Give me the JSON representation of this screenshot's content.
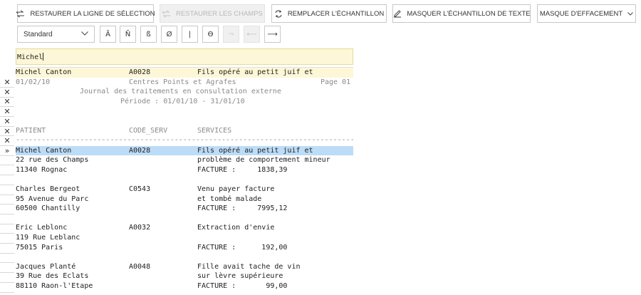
{
  "toolbar": {
    "restore_selection_line": "RESTAURER LA LIGNE DE SÉLECTION",
    "restore_fields": "RESTAURER LES CHAMPS",
    "replace_sample": "REMPLACER L'ÉCHANTILLON",
    "mask_text_sample": "MASQUER L'ÉCHANTILLON DE TEXTE",
    "erase_mask": "MASQUE D'EFFACEMENT"
  },
  "format_toolbar": {
    "style_select": "Standard",
    "buttons": [
      "Ã",
      "Ñ",
      "ß",
      "Ø",
      "|",
      "ϴ",
      "¬",
      "⟵",
      "⟶"
    ]
  },
  "search": {
    "value": "Michel"
  },
  "gutter": {
    "remove_glyph": "✕",
    "current_glyph": "»"
  },
  "header_line": {
    "c1": "Michel Canton",
    "c2": "A0028",
    "c3": "Fils opéré au petit juif et"
  },
  "report": {
    "date": "01/02/10",
    "company": "Centres Points et Agrafes",
    "page": "Page 01",
    "journal": "Journal des traitements en consultation externe",
    "period": "Période : 01/01/10 - 31/01/10",
    "col_patient": "PATIENT",
    "col_code": "CODE_SERV",
    "col_services": "SERVICES",
    "divider": "--------------------------------------------------------------------------------"
  },
  "records": [
    {
      "name": "Michel Canton",
      "code": "A0028",
      "service1": "Fils opéré au petit juif et",
      "address": "22 rue des Champs",
      "service2": "problème de comportement mineur",
      "city": "11340 Rognac",
      "invoice": "FACTURE :     1838,39"
    },
    {
      "name": "Charles Bergeot",
      "code": "C0543",
      "service1": "Venu payer facture",
      "address": "95 Avenue du Parc",
      "service2": "et tombé malade",
      "city": "60500 Chantilly",
      "invoice": "FACTURE :     7995,12"
    },
    {
      "name": "Eric Leblonc",
      "code": "A0032",
      "service1": "Extraction d'envie",
      "address": "119 Rue Leblanc",
      "service2": "",
      "city": "75015 Paris",
      "invoice": "FACTURE :      192,00"
    },
    {
      "name": "Jacques Planté",
      "code": "A0048",
      "service1": "Fille avait tache de vin",
      "address": "39 Rue des Eclats",
      "service2": "sur lèvre supérieure",
      "city": "88110 Raon-l'Etape",
      "invoice": "FACTURE :       99,00"
    }
  ]
}
